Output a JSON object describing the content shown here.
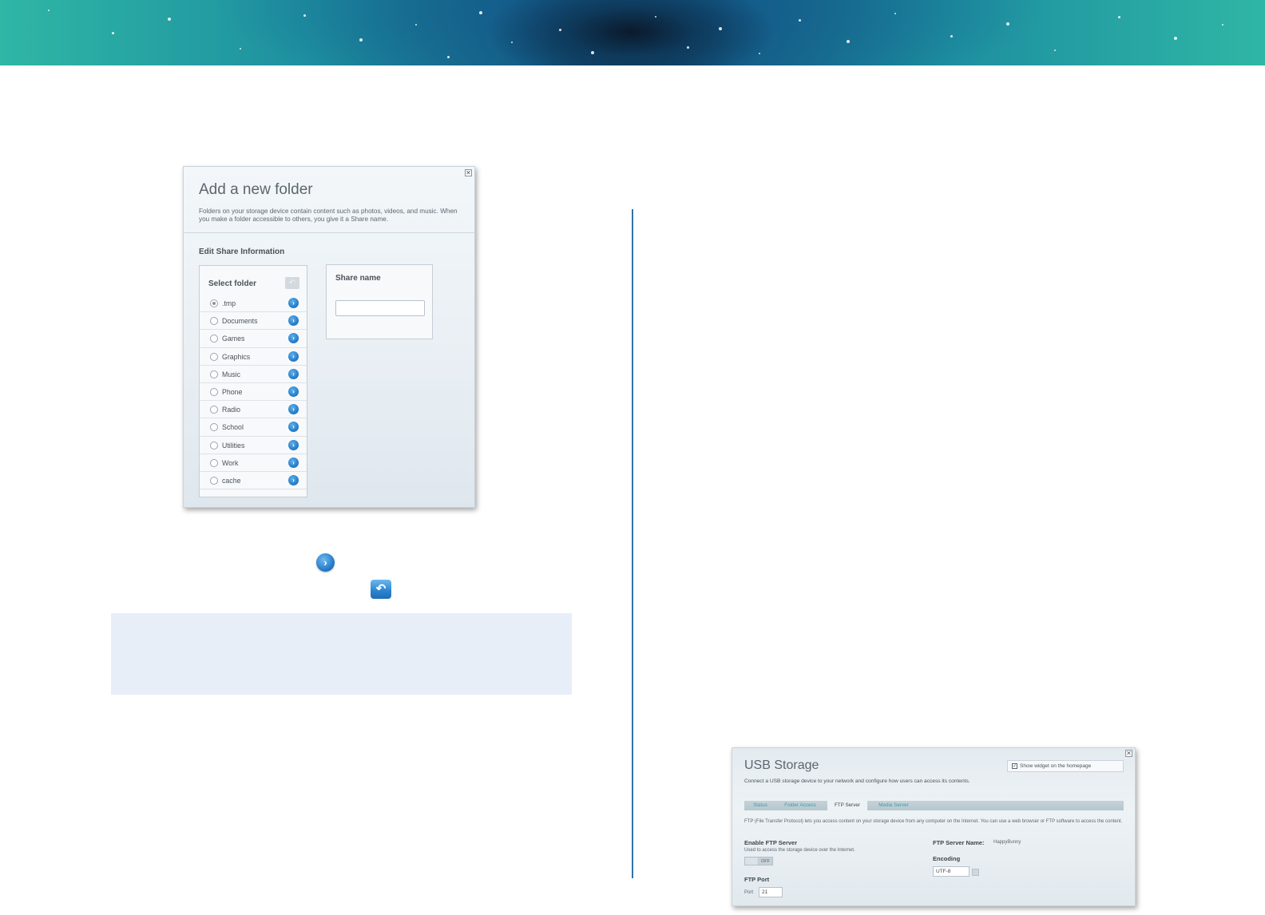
{
  "add_folder_dialog": {
    "title": "Add a new folder",
    "description": "Folders on your storage device contain content such as photos, videos, and music. When you make a folder accessible to others, you give it a Share name.",
    "section_title": "Edit Share Information",
    "select_folder_title": "Select folder",
    "folders": [
      {
        "label": ".tmp",
        "selected": true
      },
      {
        "label": "Documents",
        "selected": false
      },
      {
        "label": "Games",
        "selected": false
      },
      {
        "label": "Graphics",
        "selected": false
      },
      {
        "label": "Music",
        "selected": false
      },
      {
        "label": "Phone",
        "selected": false
      },
      {
        "label": "Radio",
        "selected": false
      },
      {
        "label": "School",
        "selected": false
      },
      {
        "label": "Utilities",
        "selected": false
      },
      {
        "label": "Work",
        "selected": false
      },
      {
        "label": "cache",
        "selected": false
      }
    ],
    "share_name_title": "Share name",
    "share_name_value": ""
  },
  "icons": {
    "close": "close-icon",
    "folder_go": "chevron-right-circle-icon",
    "up": "back-arrow-icon"
  },
  "usb_dialog": {
    "title": "USB Storage",
    "widget_label": "Show widget on the homepage",
    "widget_checked": true,
    "description": "Connect a USB storage device to your network and configure how users can access its contents.",
    "tabs": [
      {
        "label": "Status",
        "active": false
      },
      {
        "label": "Folder Access",
        "active": false
      },
      {
        "label": "FTP Server",
        "active": true
      },
      {
        "label": "Media Server",
        "active": false
      }
    ],
    "ftp_description": "FTP (File Transfer Protocol) lets you access content on your storage device from any computer on the Internet. You can use a web browser or FTP software to access the content.",
    "enable_label": "Enable FTP Server",
    "enable_sub": "Used to access the storage device over the Internet.",
    "toggle_state": "OFF",
    "port_section": "FTP Port",
    "port_label": "Port",
    "port_value": "21",
    "server_name_label": "FTP Server Name:",
    "server_name_value": "HappyBunny",
    "encoding_label": "Encoding",
    "encoding_value": "UTF-8"
  },
  "colors": {
    "divider": "#2f73a8",
    "note_box": "#e8eef8",
    "accent_blue": "#1f77c4",
    "tab_link": "#3aa0a5"
  }
}
